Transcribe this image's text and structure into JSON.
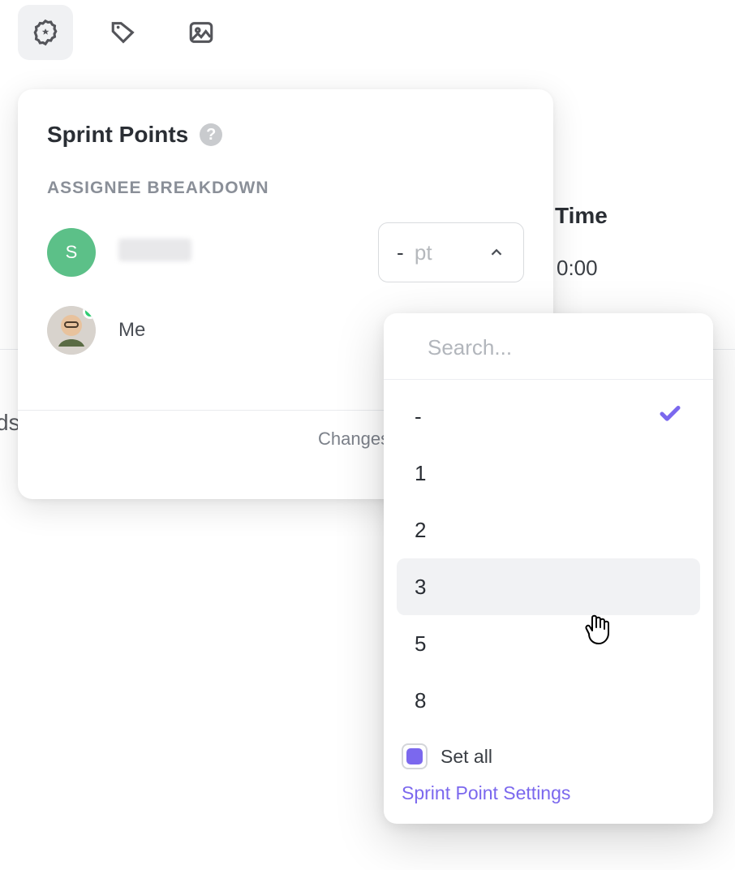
{
  "toolbar": {
    "icons": [
      "star-badge-icon",
      "tag-icon",
      "image-icon"
    ]
  },
  "card": {
    "title": "Sprint Points",
    "help_glyph": "?",
    "subheader": "ASSIGNEE BREAKDOWN",
    "assignees": [
      {
        "initial": "S",
        "name": "",
        "value": "-",
        "unit": "pt"
      },
      {
        "initial": "",
        "name": "Me",
        "value": "",
        "unit": ""
      }
    ],
    "changes_text": "Changes a"
  },
  "peek": {
    "time_label": "Time",
    "time_value": "0:00",
    "left_fragment": "ds"
  },
  "dropdown": {
    "search_placeholder": "Search...",
    "options": [
      {
        "label": "-",
        "selected": true,
        "hover": false
      },
      {
        "label": "1",
        "selected": false,
        "hover": false
      },
      {
        "label": "2",
        "selected": false,
        "hover": false
      },
      {
        "label": "3",
        "selected": false,
        "hover": true
      },
      {
        "label": "5",
        "selected": false,
        "hover": false
      },
      {
        "label": "8",
        "selected": false,
        "hover": false
      }
    ],
    "set_all_label": "Set all",
    "set_all_checked": true,
    "settings_link": "Sprint Point Settings"
  },
  "colors": {
    "accent": "#7b68ee",
    "avatar_green": "#5cc088"
  }
}
